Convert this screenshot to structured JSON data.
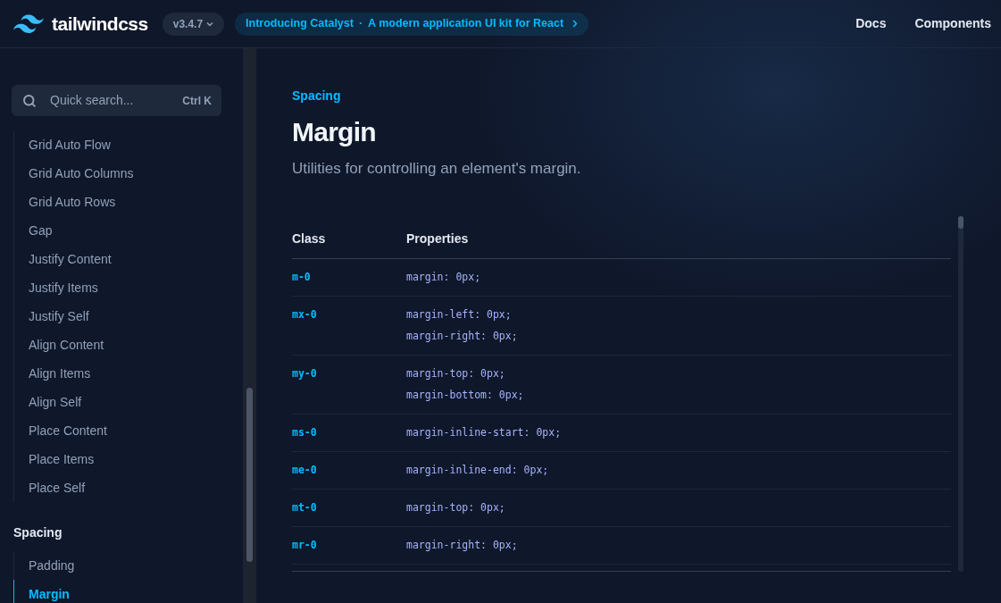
{
  "header": {
    "logo_text": "tailwindcss",
    "version": "v3.4.7",
    "announcement": {
      "title": "Introducing Catalyst",
      "separator": "·",
      "text": "A modern application UI kit for React"
    },
    "nav": [
      "Docs",
      "Components"
    ]
  },
  "sidebar": {
    "search": {
      "placeholder": "Quick search...",
      "shortcut": "Ctrl K"
    },
    "sections": [
      {
        "items": [
          {
            "label": "Grid Auto Flow",
            "selected": false
          },
          {
            "label": "Grid Auto Columns",
            "selected": false
          },
          {
            "label": "Grid Auto Rows",
            "selected": false
          },
          {
            "label": "Gap",
            "selected": false
          },
          {
            "label": "Justify Content",
            "selected": false
          },
          {
            "label": "Justify Items",
            "selected": false
          },
          {
            "label": "Justify Self",
            "selected": false
          },
          {
            "label": "Align Content",
            "selected": false
          },
          {
            "label": "Align Items",
            "selected": false
          },
          {
            "label": "Align Self",
            "selected": false
          },
          {
            "label": "Place Content",
            "selected": false
          },
          {
            "label": "Place Items",
            "selected": false
          },
          {
            "label": "Place Self",
            "selected": false
          }
        ]
      },
      {
        "title": "Spacing",
        "items": [
          {
            "label": "Padding",
            "selected": false
          },
          {
            "label": "Margin",
            "selected": true
          }
        ]
      }
    ]
  },
  "page": {
    "eyebrow": "Spacing",
    "title": "Margin",
    "description": "Utilities for controlling an element's margin.",
    "table": {
      "columns": [
        "Class",
        "Properties"
      ],
      "rows": [
        {
          "class": "m-0",
          "properties": [
            "margin: 0px;"
          ]
        },
        {
          "class": "mx-0",
          "properties": [
            "margin-left: 0px;",
            "margin-right: 0px;"
          ]
        },
        {
          "class": "my-0",
          "properties": [
            "margin-top: 0px;",
            "margin-bottom: 0px;"
          ]
        },
        {
          "class": "ms-0",
          "properties": [
            "margin-inline-start: 0px;"
          ]
        },
        {
          "class": "me-0",
          "properties": [
            "margin-inline-end: 0px;"
          ]
        },
        {
          "class": "mt-0",
          "properties": [
            "margin-top: 0px;"
          ]
        },
        {
          "class": "mr-0",
          "properties": [
            "margin-right: 0px;"
          ]
        }
      ]
    }
  }
}
